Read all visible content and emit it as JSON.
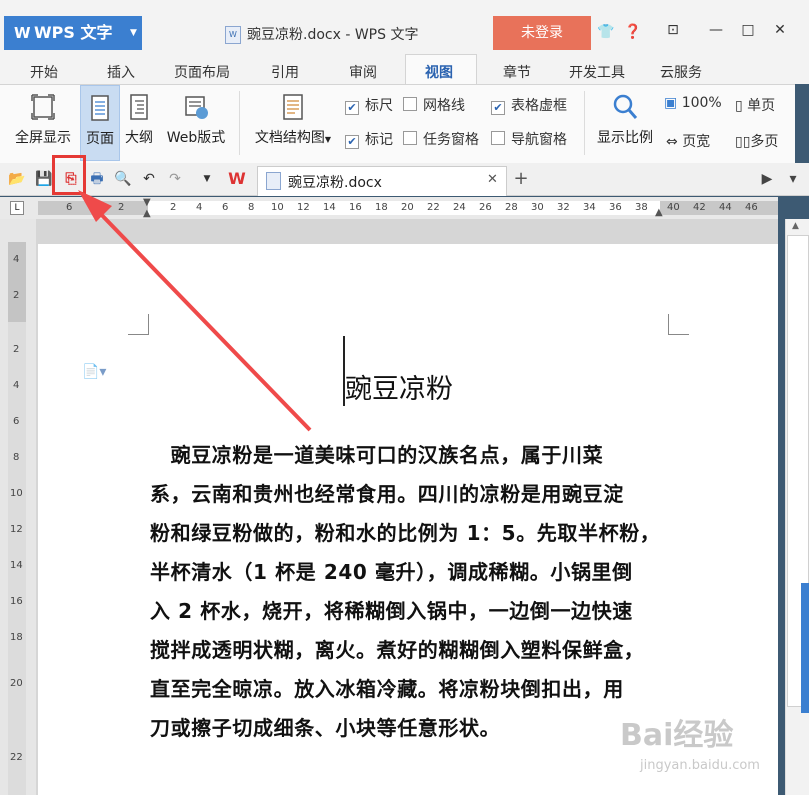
{
  "app": {
    "name": "WPS 文字",
    "document_title": "豌豆凉粉.docx - WPS 文字",
    "login_label": "未登录"
  },
  "menu_tabs": [
    "开始",
    "插入",
    "页面布局",
    "引用",
    "审阅",
    "视图",
    "章节",
    "开发工具",
    "云服务"
  ],
  "active_tab": "视图",
  "ribbon": {
    "fullscreen": "全屏显示",
    "page": "页面",
    "outline": "大纲",
    "web": "Web版式",
    "doc_structure": "文档结构图",
    "ruler": "标尺",
    "gridlines": "网格线",
    "table_gridlines": "表格虚框",
    "marks": "标记",
    "task_pane": "任务窗格",
    "nav_pane": "导航窗格",
    "zoom": "显示比例",
    "zoom_100": "100%",
    "page_width": "页宽",
    "single_page": "单页",
    "multi_page": "多页"
  },
  "document_tab": {
    "name": "豌豆凉粉.docx"
  },
  "ruler_numbers": [
    "6",
    "2",
    "2",
    "4",
    "6",
    "8",
    "10",
    "12",
    "14",
    "16",
    "18",
    "20",
    "22",
    "24",
    "26",
    "28",
    "30",
    "32",
    "34",
    "36",
    "38",
    "40",
    "42",
    "44",
    "46"
  ],
  "vruler_numbers": [
    "4",
    "2",
    "2",
    "4",
    "6",
    "8",
    "10",
    "12",
    "14",
    "16",
    "18",
    "20",
    "22"
  ],
  "document": {
    "heading": "豌豆凉粉",
    "lines": [
      "　豌豆凉粉是一道美味可口的汉族名点，属于川菜",
      "系，云南和贵州也经常食用。四川的凉粉是用豌豆淀",
      "粉和绿豆粉做的，粉和水的比例为 1：5。先取半杯粉，",
      "半杯清水（1 杯是 240 毫升），调成稀糊。小锅里倒",
      "入 2 杯水，烧开，将稀糊倒入锅中，一边倒一边快速",
      "搅拌成透明状糊，离火。煮好的糊糊倒入塑料保鲜盒，",
      "直至完全晾凉。放入冰箱冷藏。将凉粉块倒扣出，用",
      "刀或擦子切成细条、小块等任意形状。"
    ]
  },
  "watermark": {
    "brand": "Bai经验",
    "url": "jingyan.baidu.com"
  },
  "colors": {
    "accent": "#3b7fd0",
    "login": "#e8725a",
    "highlight": "#e53935"
  }
}
